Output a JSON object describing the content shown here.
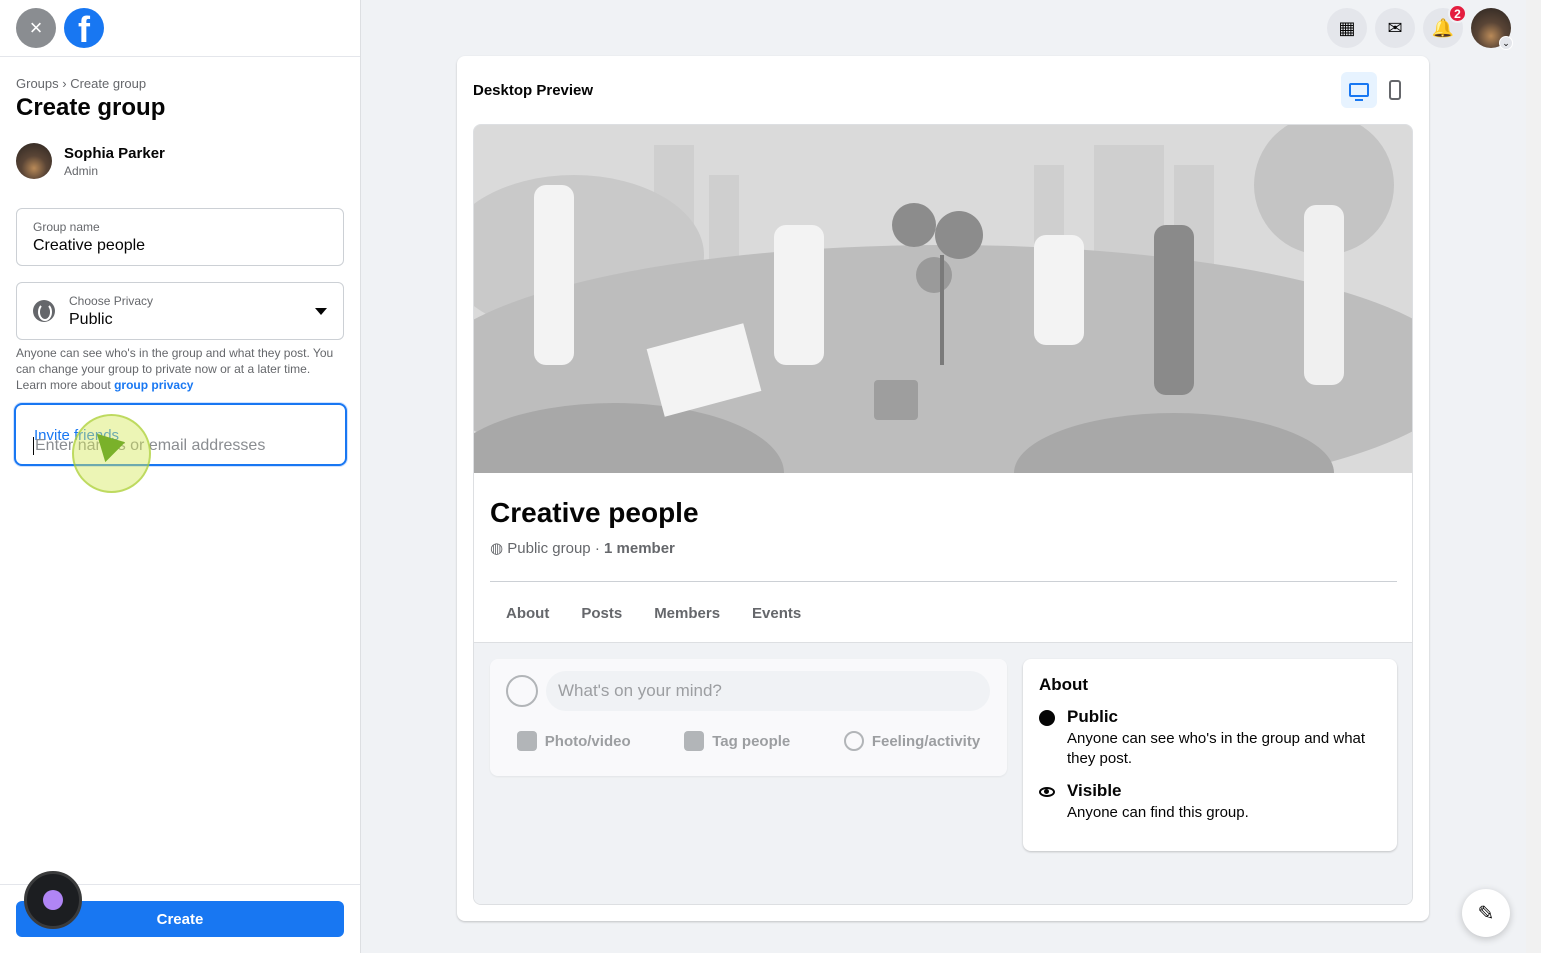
{
  "left": {
    "close_icon": "×",
    "breadcrumb_parent": "Groups",
    "breadcrumb_sep": " › ",
    "breadcrumb_current": "Create group",
    "title": "Create group",
    "admin_name": "Sophia Parker",
    "admin_role": "Admin",
    "group_name_label": "Group name",
    "group_name_value": "Creative people",
    "privacy_label": "Choose Privacy",
    "privacy_value": "Public",
    "privacy_help": "Anyone can see who's in the group and what they post. You can change your group to private now or at a later time. Learn more about ",
    "privacy_link": "group privacy",
    "invite_label": "Invite friends",
    "invite_placeholder": "Enter names or email addresses",
    "create_label": "Create"
  },
  "nav": {
    "notifications_badge": "2",
    "menu_icon": "▦",
    "messenger_icon": "✉",
    "bell_icon": "🔔",
    "chevron": "⌄"
  },
  "preview": {
    "title": "Desktop Preview",
    "group_name": "Creative people",
    "group_type": "Public group",
    "meta_sep": " · ",
    "member_count": "1 member",
    "tabs": [
      "About",
      "Posts",
      "Members",
      "Events"
    ],
    "composer_placeholder": "What's on your mind?",
    "actions": [
      "Photo/video",
      "Tag people",
      "Feeling/activity"
    ],
    "about_title": "About",
    "about_public_head": "Public",
    "about_public_desc": "Anyone can see who's in the group and what they post.",
    "about_visible_head": "Visible",
    "about_visible_desc": "Anyone can find this group."
  },
  "edit_icon": "✎",
  "colors": {
    "accent": "#1877f2",
    "badge": "#e41e3f"
  }
}
